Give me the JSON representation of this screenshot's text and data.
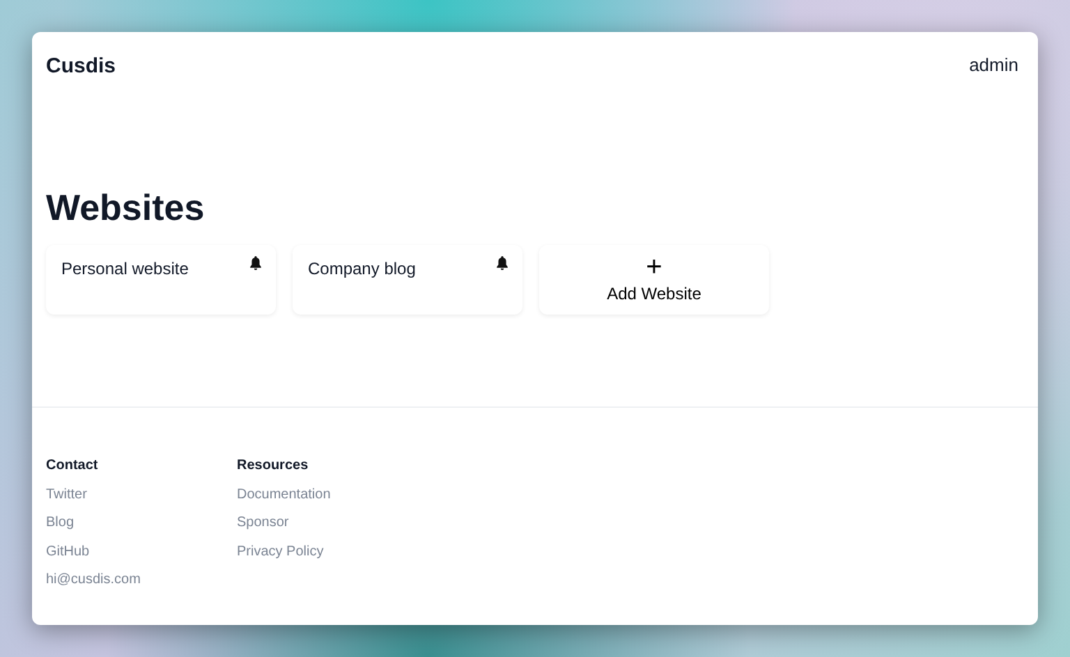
{
  "header": {
    "brand": "Cusdis",
    "user": "admin"
  },
  "page": {
    "title": "Websites"
  },
  "websites": [
    {
      "name": "Personal website"
    },
    {
      "name": "Company blog"
    }
  ],
  "add_card": {
    "icon": "+",
    "label": "Add Website"
  },
  "footer": {
    "columns": [
      {
        "heading": "Contact",
        "links": [
          "Twitter",
          "Blog",
          "GitHub",
          "hi@cusdis.com"
        ]
      },
      {
        "heading": "Resources",
        "links": [
          "Documentation",
          "Sponsor",
          "Privacy Policy"
        ]
      }
    ]
  }
}
